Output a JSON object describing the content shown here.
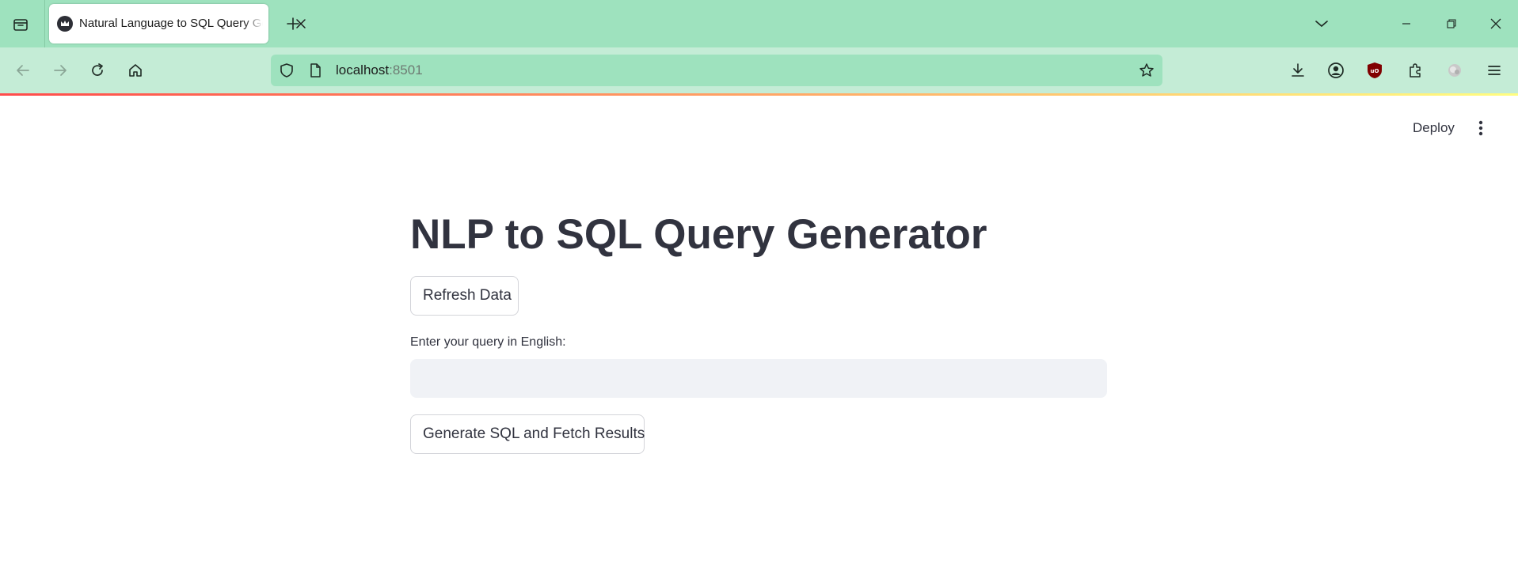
{
  "browser": {
    "tab": {
      "title": "Natural Language to SQL Query Generator",
      "favicon": "streamlit-crown-icon"
    },
    "window_controls": [
      "list-all-tabs-icon",
      "minimize-icon",
      "restore-icon",
      "close-icon"
    ],
    "nav": {
      "back_icon": "back-arrow-icon",
      "forward_icon": "forward-arrow-icon",
      "reload_icon": "reload-icon",
      "home_icon": "home-icon"
    },
    "url": {
      "host": "localhost",
      "port": ":8501"
    },
    "toolbar_icons": [
      "downloads-icon",
      "account-icon",
      "ublock-icon",
      "extensions-icon",
      "extension-puzzle-icon",
      "menu-icon"
    ]
  },
  "app": {
    "header": {
      "deploy_label": "Deploy"
    },
    "main": {
      "title": "NLP to SQL Query Generator",
      "refresh_label": "Refresh Data",
      "query_label": "Enter your query in English:",
      "query_value": "",
      "generate_label": "Generate SQL and Fetch Results"
    }
  },
  "colors": {
    "tabstrip_bg": "#9ee2be",
    "navbar_bg": "#c4ecd6",
    "text": "#31333f",
    "input_bg": "#f0f2f6",
    "decoration_start": "#ff4b4b",
    "decoration_end": "#fffd80"
  }
}
